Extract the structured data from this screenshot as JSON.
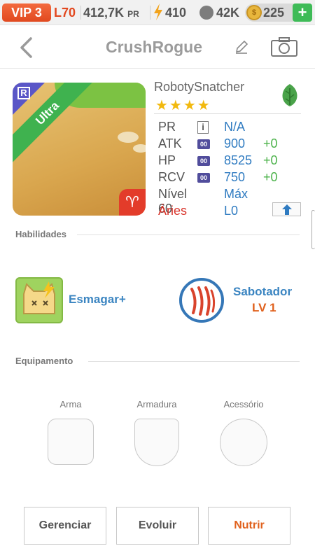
{
  "status_bar": {
    "vip": "VIP 3",
    "level": "L70",
    "power": "412,7K",
    "power_unit": "PR",
    "energy": "410",
    "friends": "42K",
    "coins": "225",
    "add_label": "+",
    "icons": [
      "bolt-icon",
      "paw-icon",
      "coin-icon",
      "plus-icon"
    ]
  },
  "header": {
    "title": "CrushRogue",
    "icons": [
      "back-icon",
      "edit-icon",
      "camera-icon"
    ]
  },
  "card": {
    "ribbon": "Ultra",
    "rank_letter": "R",
    "zodiac_symbol": "♈"
  },
  "pet": {
    "name": "RobotySnatcher",
    "stars": "★★★★",
    "star_count": 4,
    "element_icon": "leaf-icon",
    "stats": [
      {
        "label": "PR",
        "badge": "i",
        "value": "N/A",
        "plus": ""
      },
      {
        "label": "ATK",
        "badge": "00",
        "value": "900",
        "plus": "+0"
      },
      {
        "label": "HP",
        "badge": "00",
        "value": "8525",
        "plus": "+0"
      },
      {
        "label": "RCV",
        "badge": "00",
        "value": "750",
        "plus": "+0"
      }
    ],
    "level_label": "Nível 60",
    "level_value": "Máx",
    "sign_label": "Áries",
    "sign_value": "L0"
  },
  "abilities": {
    "title": "Habilidades",
    "skill_name": "Esmagar+",
    "lead_name": "Sabotador",
    "lead_level": "LV 1"
  },
  "equipment": {
    "title": "Equipamento",
    "slots": [
      "Arma",
      "Armadura",
      "Acessório"
    ]
  },
  "actions": {
    "manage": "Gerenciar",
    "evolve": "Evoluir",
    "feed": "Nutrir"
  },
  "colors": {
    "accent_orange": "#e0611d",
    "value_blue": "#2f7bc1",
    "plus_green": "#4bb24a",
    "vip_red": "#e1491f"
  }
}
